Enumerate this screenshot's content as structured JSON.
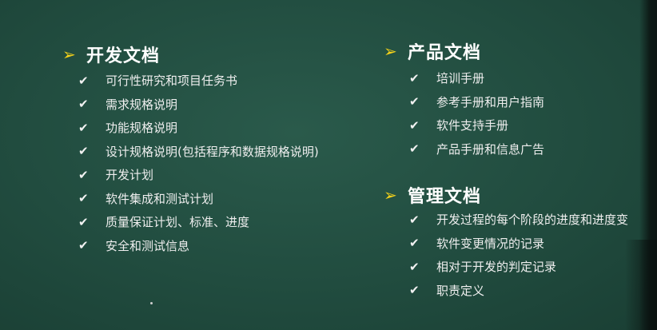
{
  "colors": {
    "background": "#214c3f",
    "arrow": "#f5d21a",
    "text": "#ffffff"
  },
  "sections": [
    {
      "heading": "开发文档",
      "items": [
        "可行性研究和项目任务书",
        "需求规格说明",
        "功能规格说明",
        "设计规格说明(包括程序和数据规格说明)",
        "开发计划",
        "软件集成和测试计划",
        "质量保证计划、标准、进度",
        "安全和测试信息"
      ]
    },
    {
      "heading": "产品文档",
      "items": [
        "培训手册",
        "参考手册和用户指南",
        "软件支持手册",
        "产品手册和信息广告"
      ]
    },
    {
      "heading": "管理文档",
      "items": [
        "开发过程的每个阶段的进度和进度变",
        "软件变更情况的记录",
        "相对于开发的判定记录",
        "职责定义"
      ]
    }
  ],
  "icons": {
    "bullet": "arrow-right-icon",
    "check": "check-icon"
  }
}
